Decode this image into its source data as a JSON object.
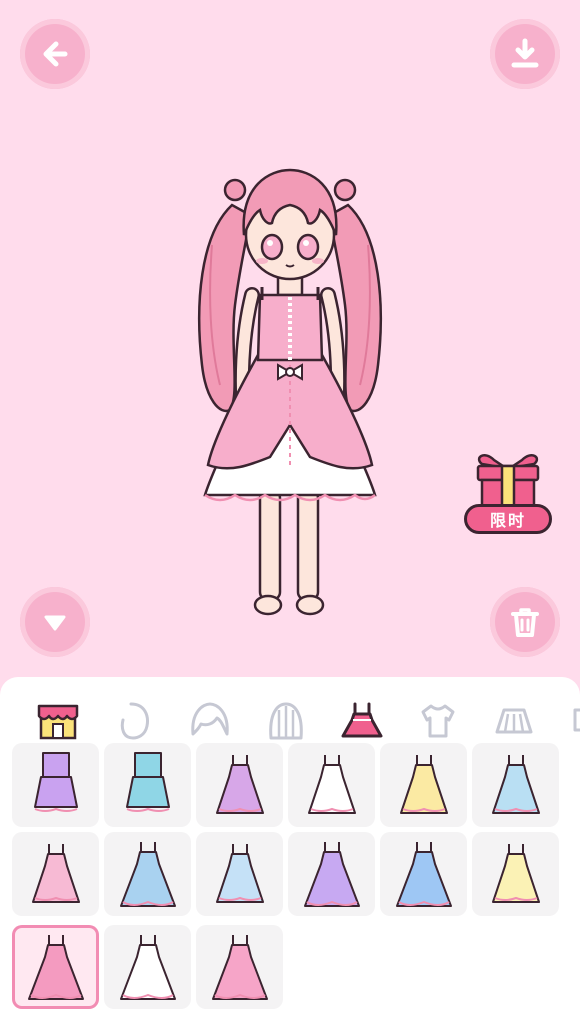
{
  "top_bar": {
    "back_icon": "arrow-left-icon",
    "save_icon": "download-icon"
  },
  "side_controls": {
    "collapse_icon": "chevron-down-icon",
    "delete_icon": "trash-icon"
  },
  "promo": {
    "label": "限时",
    "icon": "gift-box-icon"
  },
  "colors": {
    "background": "#ffdcec",
    "button_pink": "#f7b1cc",
    "accent": "#f0608e",
    "panel": "#ffffff",
    "cell": "#f4f3f4"
  },
  "categories": [
    {
      "name": "shop",
      "icon": "shop-icon",
      "selected": false
    },
    {
      "name": "face",
      "icon": "face-icon",
      "selected": false
    },
    {
      "name": "front-hair",
      "icon": "hair-front-icon",
      "selected": false
    },
    {
      "name": "back-hair",
      "icon": "hair-back-icon",
      "selected": false
    },
    {
      "name": "dress",
      "icon": "dress-icon",
      "selected": true
    },
    {
      "name": "top",
      "icon": "shirt-icon",
      "selected": false
    },
    {
      "name": "skirt",
      "icon": "skirt-icon",
      "selected": false
    },
    {
      "name": "shorts",
      "icon": "shorts-icon",
      "selected": false
    }
  ],
  "items": [
    {
      "row": 0,
      "col": 0,
      "color": "#c9a2f0",
      "type": "outfit-skirt"
    },
    {
      "row": 0,
      "col": 1,
      "color": "#8fd6e6",
      "type": "outfit-skirt"
    },
    {
      "row": 0,
      "col": 2,
      "color": "#d7a7e8",
      "type": "dress"
    },
    {
      "row": 0,
      "col": 3,
      "color": "#ffffff",
      "type": "dress"
    },
    {
      "row": 0,
      "col": 4,
      "color": "#fbeaa3",
      "type": "dress"
    },
    {
      "row": 0,
      "col": 5,
      "color": "#b9dff3",
      "type": "dress"
    },
    {
      "row": 1,
      "col": 0,
      "color": "#f7bad4",
      "type": "dress"
    },
    {
      "row": 1,
      "col": 1,
      "color": "#a9d2f0",
      "type": "gown"
    },
    {
      "row": 1,
      "col": 2,
      "color": "#c5e1f7",
      "type": "dress"
    },
    {
      "row": 1,
      "col": 3,
      "color": "#c7a9f2",
      "type": "gown"
    },
    {
      "row": 1,
      "col": 4,
      "color": "#9ec7f4",
      "type": "gown"
    },
    {
      "row": 1,
      "col": 5,
      "color": "#fbf2b5",
      "type": "dress"
    },
    {
      "row": 2,
      "col": 0,
      "color": "#f49bc0",
      "type": "gown",
      "selected": true
    },
    {
      "row": 2,
      "col": 1,
      "color": "#ffffff",
      "type": "gown"
    },
    {
      "row": 2,
      "col": 2,
      "color": "#f6a5c8",
      "type": "gown"
    }
  ]
}
